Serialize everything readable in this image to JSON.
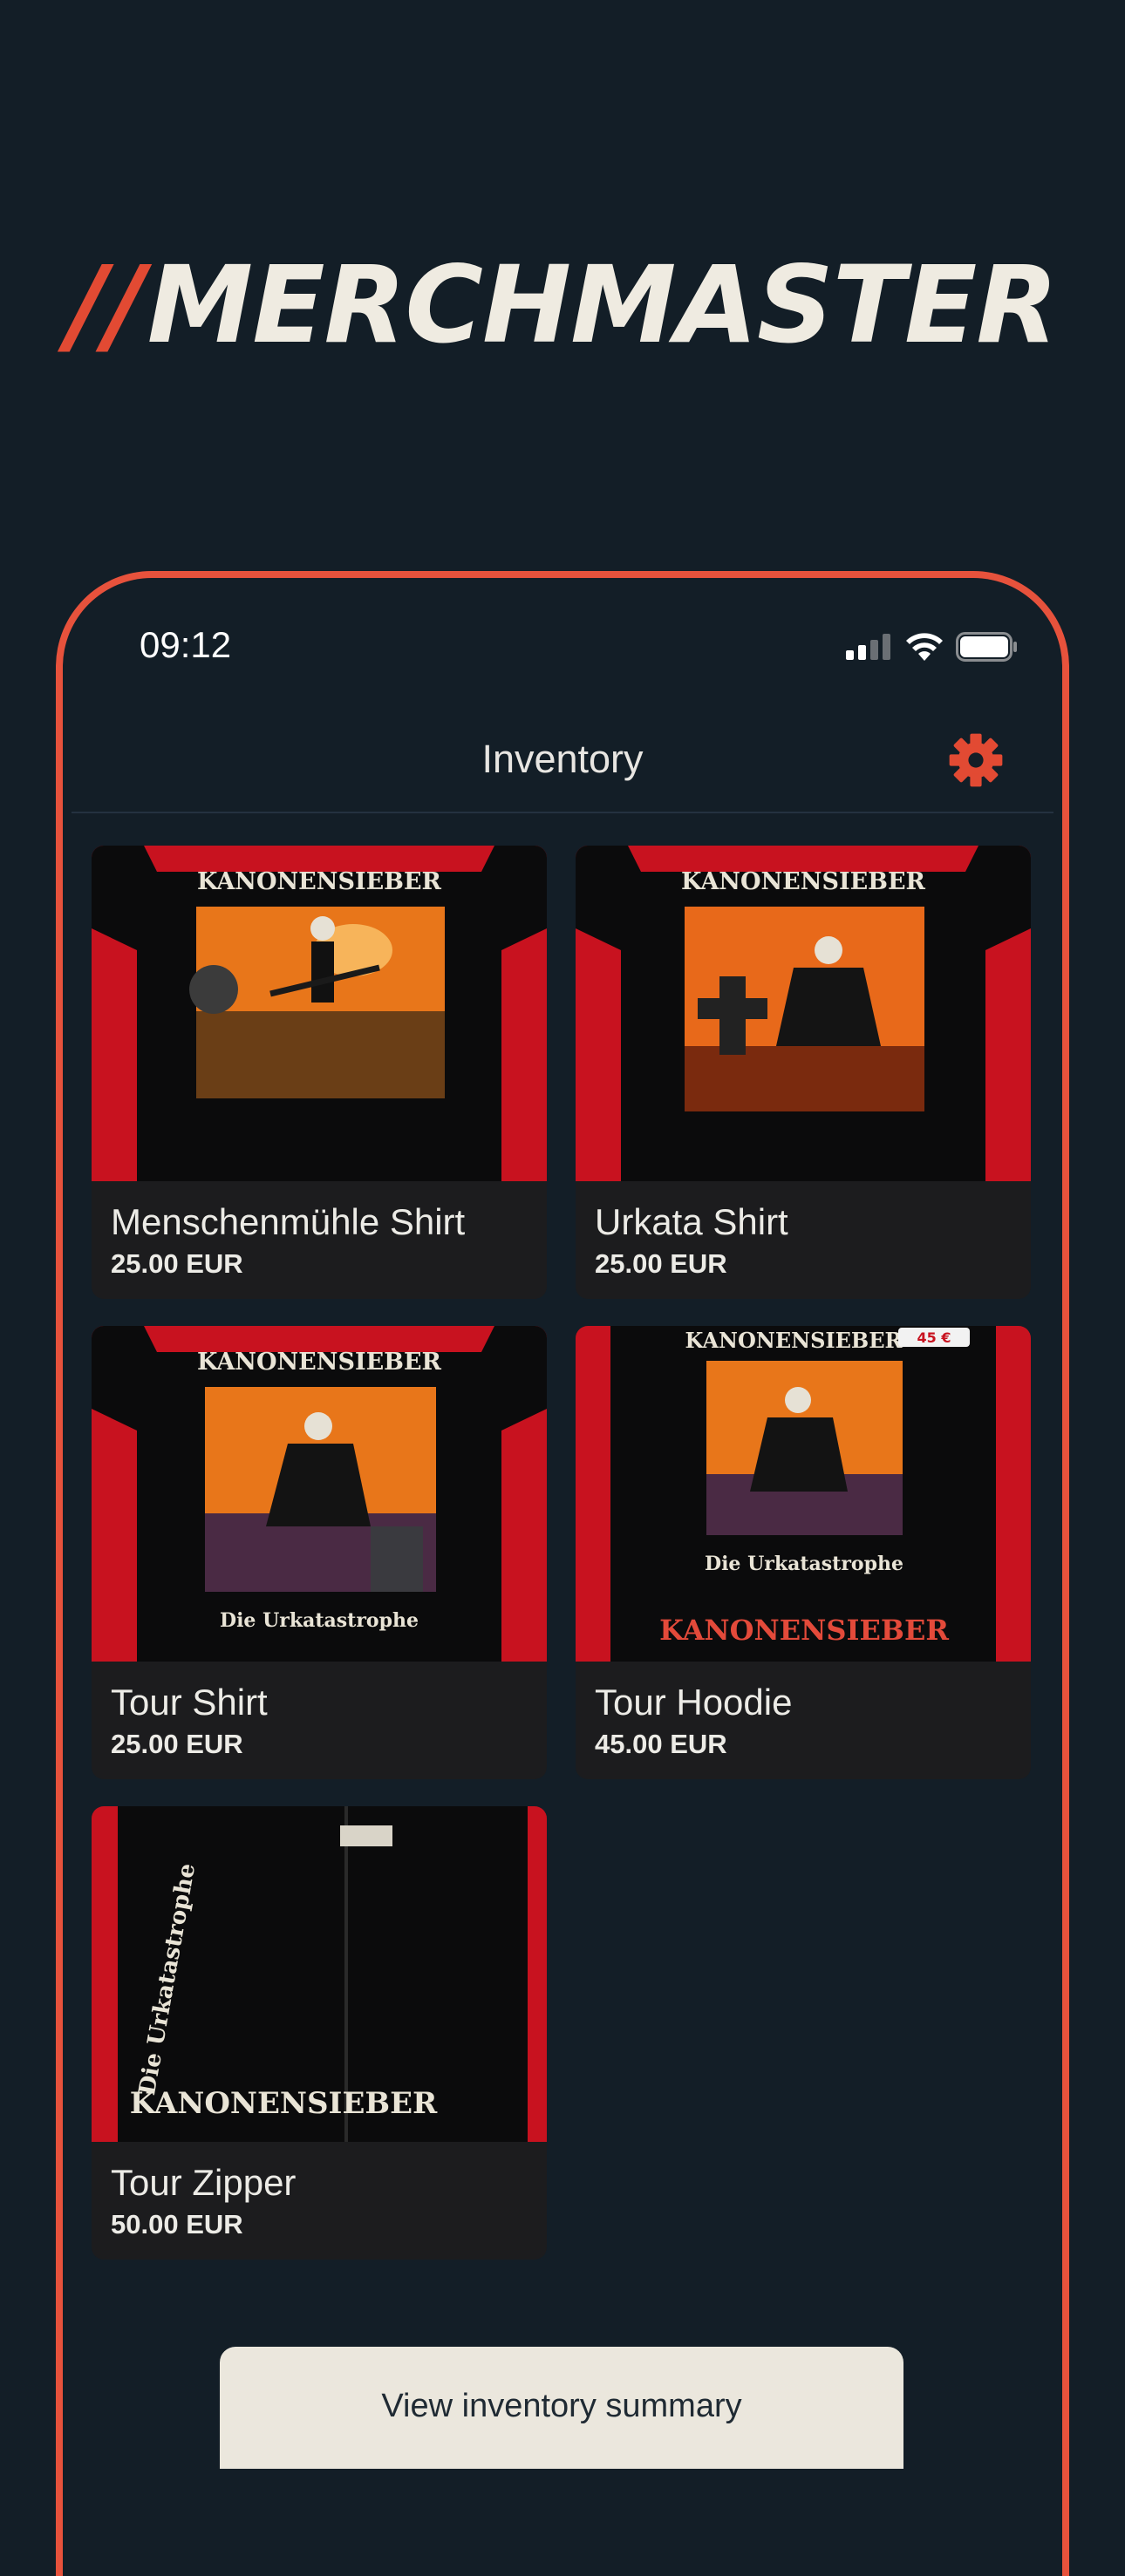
{
  "brand": {
    "slashes": "//",
    "name": "MERCHMASTER"
  },
  "status_bar": {
    "time": "09:12"
  },
  "navbar": {
    "title": "Inventory"
  },
  "items": [
    {
      "name": "Menschenmühle Shirt",
      "price": "25.00 EUR",
      "print_text": "KANONENSIEBER",
      "caption": ""
    },
    {
      "name": "Urkata Shirt",
      "price": "25.00 EUR",
      "print_text": "KANONENSIEBER",
      "caption": ""
    },
    {
      "name": "Tour Shirt",
      "price": "25.00 EUR",
      "print_text": "KANONENSIEBER",
      "caption": "Die Urkatastrophe"
    },
    {
      "name": "Tour Hoodie",
      "price": "45.00 EUR",
      "print_text": "KANONENSIEBER",
      "caption": "Die Urkatastrophe",
      "tag": "45 €"
    },
    {
      "name": "Tour Zipper",
      "price": "50.00 EUR",
      "print_text": "KANONENSIEBER",
      "caption": "Die Urkatastrophe"
    }
  ],
  "footer": {
    "summary_button": "View inventory summary"
  },
  "colors": {
    "accent": "#e24a33",
    "background": "#131e27",
    "card": "#1c1c1e",
    "button": "#ebe7dd"
  }
}
